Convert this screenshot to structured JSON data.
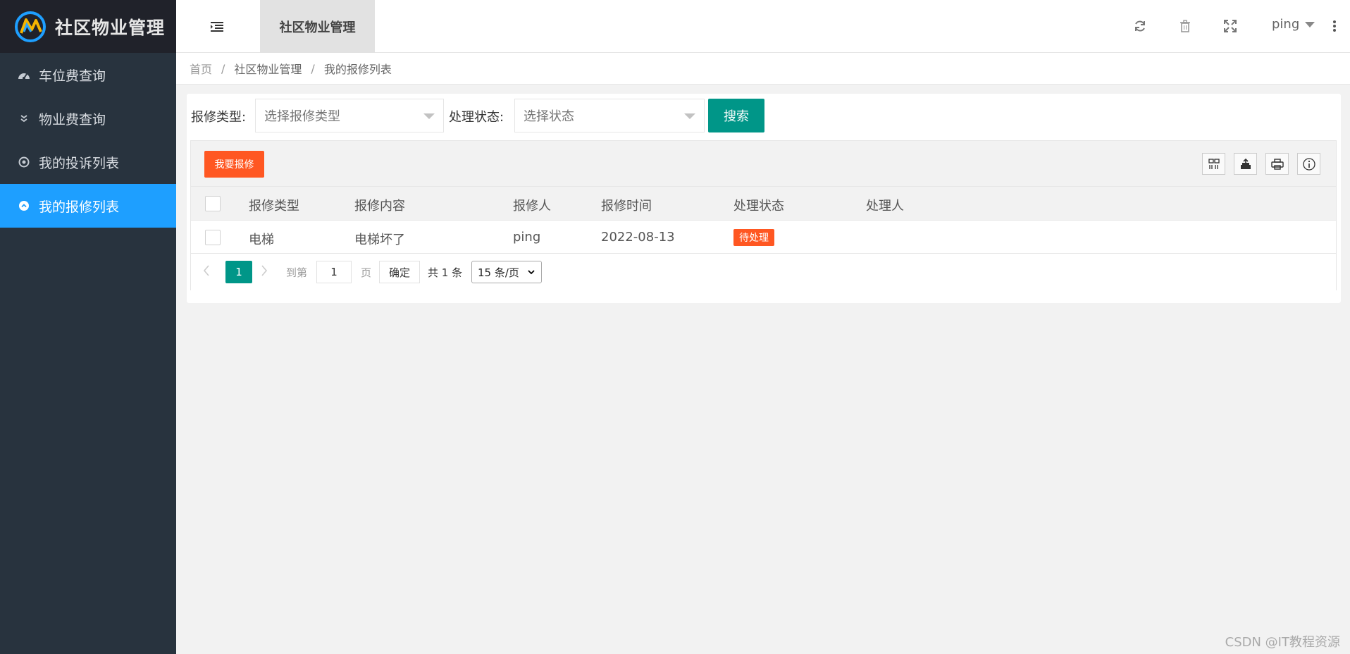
{
  "app": {
    "title": "社区物业管理"
  },
  "sidebar": {
    "items": [
      {
        "label": "车位费查询",
        "icon": "dashboard-icon",
        "active": false
      },
      {
        "label": "物业费查询",
        "icon": "double-chevron-icon",
        "active": false
      },
      {
        "label": "我的投诉列表",
        "icon": "target-icon",
        "active": false
      },
      {
        "label": "我的报修列表",
        "icon": "circle-up-icon",
        "active": true
      }
    ]
  },
  "header": {
    "tab_label": "社区物业管理",
    "user": "ping",
    "icons": [
      "refresh-icon",
      "trash-icon",
      "fullscreen-icon",
      "more-vertical-icon"
    ]
  },
  "breadcrumb": [
    "首页",
    "社区物业管理",
    "我的报修列表"
  ],
  "search": {
    "type_label": "报修类型:",
    "type_placeholder": "选择报修类型",
    "status_label": "处理状态:",
    "status_placeholder": "选择状态",
    "search_button": "搜索"
  },
  "toolbar": {
    "add_button": "我要报修",
    "tools": [
      "columns-icon",
      "export-icon",
      "print-icon",
      "info-icon"
    ]
  },
  "table": {
    "columns": [
      "报修类型",
      "报修内容",
      "报修人",
      "报修时间",
      "处理状态",
      "处理人"
    ],
    "rows": [
      {
        "type": "电梯",
        "content": "电梯坏了",
        "reporter": "ping",
        "time": "2022-08-13",
        "status": "待处理",
        "handler": ""
      }
    ]
  },
  "pager": {
    "current": "1",
    "goto_label": "到第",
    "goto_value": "1",
    "page_label": "页",
    "ok_label": "确定",
    "total": "共 1 条",
    "page_size": "15 条/页"
  },
  "colors": {
    "sidebar": "#28333e",
    "active": "#1e9fff",
    "primary": "#009688",
    "warn": "#ff5722"
  },
  "watermark": "CSDN @IT教程资源"
}
